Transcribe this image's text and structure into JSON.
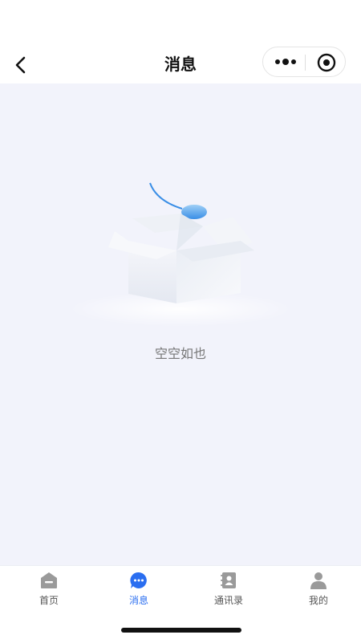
{
  "header": {
    "title": "消息"
  },
  "empty_state": {
    "text": "空空如也"
  },
  "tabbar": {
    "items": [
      {
        "label": "首页",
        "icon": "home-icon",
        "active": false
      },
      {
        "label": "消息",
        "icon": "message-icon",
        "active": true
      },
      {
        "label": "通讯录",
        "icon": "contacts-icon",
        "active": false
      },
      {
        "label": "我的",
        "icon": "profile-icon",
        "active": false
      }
    ]
  },
  "colors": {
    "accent": "#2a6ef0",
    "background": "#f2f3fb",
    "inactive_icon": "#9a9a9a"
  }
}
